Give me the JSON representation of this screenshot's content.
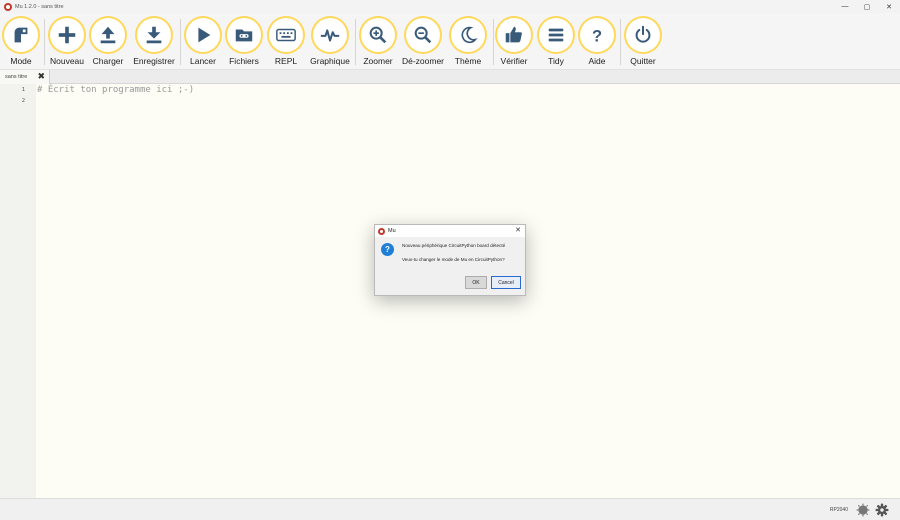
{
  "window": {
    "title": "Mu 1.2.0 - sans titre",
    "minimize": "—",
    "maximize": "▢",
    "close": "✕"
  },
  "toolbar": {
    "mode": "Mode",
    "nouveau": "Nouveau",
    "charger": "Charger",
    "enregistrer": "Enregistrer",
    "lancer": "Lancer",
    "fichiers": "Fichiers",
    "repl": "REPL",
    "graphique": "Graphique",
    "zoomer": "Zoomer",
    "dezoomer": "Dé-zoomer",
    "theme": "Thème",
    "verifier": "Vérifier",
    "tidy": "Tidy",
    "aide": "Aide",
    "quitter": "Quitter",
    "accent_color": "#ffd85a",
    "icon_color": "#3a5a7a"
  },
  "tab": {
    "label": "sans titre",
    "close": "✖"
  },
  "editor": {
    "line_numbers": [
      "1",
      "2"
    ],
    "code_line_1": "# Écrit ton programme ici ;-)"
  },
  "status": {
    "mode": "RP2040"
  },
  "dialog": {
    "title": "Mu",
    "close": "✕",
    "icon": "?",
    "message1": "Nouveau périphérique CircuitPython board détecté",
    "message2": "Veux-tu changer le mode de Mu en CircuitPython?",
    "ok": "OK",
    "cancel": "Cancel"
  }
}
